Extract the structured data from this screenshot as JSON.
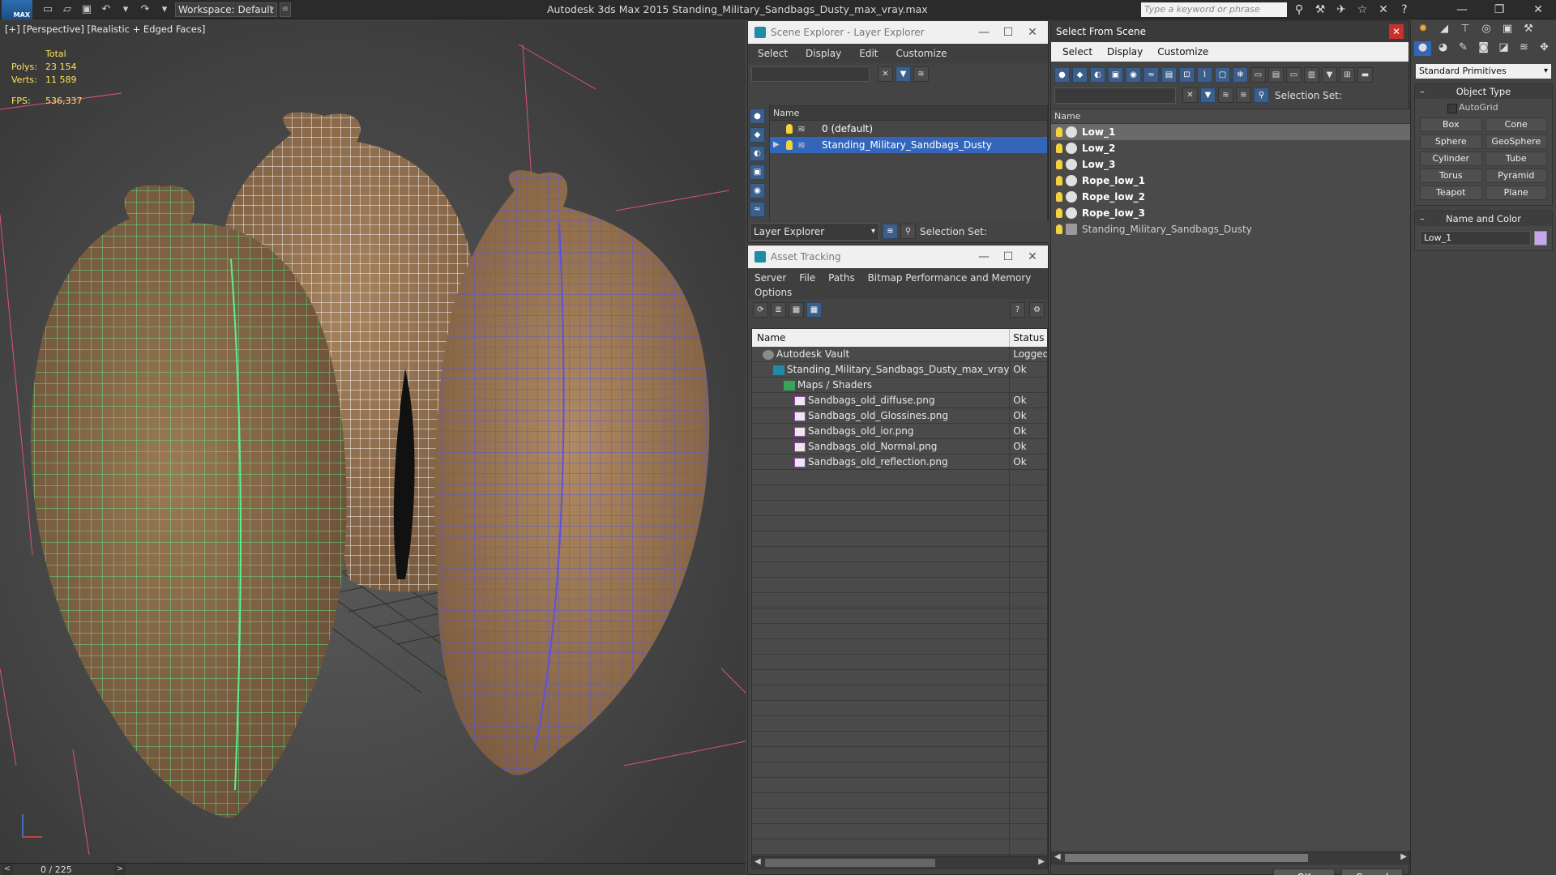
{
  "titlebar": {
    "logo_text": "MAX",
    "workspace": "Workspace: Default",
    "app_title": "Autodesk 3ds Max  2015     Standing_Military_Sandbags_Dusty_max_vray.max",
    "search_placeholder": "Type a keyword or phrase"
  },
  "viewport": {
    "label": "[+] [Perspective] [Realistic + Edged Faces]",
    "stats_header": "Total",
    "stats": [
      {
        "k": "Polys:",
        "v": "23 154"
      },
      {
        "k": "Verts:",
        "v": "11 589"
      }
    ],
    "fps_label": "FPS:",
    "fps_value": "536,337",
    "timeline": "0 / 225",
    "prev": "<",
    "next": ">",
    "colors": {
      "green_wire": "#5df08a",
      "blue_wire": "#5a52e0",
      "white_wire": "#ffffff",
      "sack": "#8b6a48"
    }
  },
  "scene_explorer": {
    "title": "Scene Explorer - Layer Explorer",
    "menu": [
      "Select",
      "Display",
      "Edit",
      "Customize"
    ],
    "col_name": "Name",
    "rows": [
      {
        "label": "0 (default)",
        "selected": false
      },
      {
        "label": "Standing_Military_Sandbags_Dusty",
        "selected": true
      }
    ],
    "footer_dropdown": "Layer Explorer",
    "selection_set": "Selection Set:"
  },
  "asset_tracking": {
    "title": "Asset Tracking",
    "menu_line1": [
      "Server",
      "File",
      "Paths",
      "Bitmap Performance and Memory"
    ],
    "menu_line2": [
      "Options"
    ],
    "col_name": "Name",
    "col_status": "Status",
    "rows": [
      {
        "name": "Autodesk Vault",
        "status": "Logged",
        "indent": 1,
        "icon": "vault"
      },
      {
        "name": "Standing_Military_Sandbags_Dusty_max_vray.m...",
        "status": "Ok",
        "indent": 2,
        "icon": "max"
      },
      {
        "name": "Maps / Shaders",
        "status": "",
        "indent": 3,
        "icon": "folder"
      },
      {
        "name": "Sandbags_old_diffuse.png",
        "status": "Ok",
        "indent": 4,
        "icon": "png"
      },
      {
        "name": "Sandbags_old_Glossines.png",
        "status": "Ok",
        "indent": 4,
        "icon": "png"
      },
      {
        "name": "Sandbags_old_ior.png",
        "status": "Ok",
        "indent": 4,
        "icon": "png"
      },
      {
        "name": "Sandbags_old_Normal.png",
        "status": "Ok",
        "indent": 4,
        "icon": "png"
      },
      {
        "name": "Sandbags_old_reflection.png",
        "status": "Ok",
        "indent": 4,
        "icon": "png"
      }
    ]
  },
  "select_from_scene": {
    "title": "Select From Scene",
    "menu": [
      "Select",
      "Display",
      "Customize"
    ],
    "selection_set": "Selection Set:",
    "col_name": "Name",
    "rows": [
      {
        "label": "Low_1",
        "selected": true,
        "light": false
      },
      {
        "label": "Low_2",
        "selected": false,
        "light": false
      },
      {
        "label": "Low_3",
        "selected": false,
        "light": false
      },
      {
        "label": "Rope_low_1",
        "selected": false,
        "light": false
      },
      {
        "label": "Rope_low_2",
        "selected": false,
        "light": false
      },
      {
        "label": "Rope_low_3",
        "selected": false,
        "light": false
      },
      {
        "label": "Standing_Military_Sandbags_Dusty",
        "selected": false,
        "light": true
      }
    ],
    "ok": "OK",
    "cancel": "Cancel"
  },
  "command_panel": {
    "category": "Standard Primitives",
    "object_type_title": "Object Type",
    "autogrid": "AutoGrid",
    "buttons": [
      "Box",
      "Cone",
      "Sphere",
      "GeoSphere",
      "Cylinder",
      "Tube",
      "Torus",
      "Pyramid",
      "Teapot",
      "Plane"
    ],
    "name_color_title": "Name and Color",
    "name_value": "Low_1",
    "swatch_color": "#c6a6ee"
  }
}
